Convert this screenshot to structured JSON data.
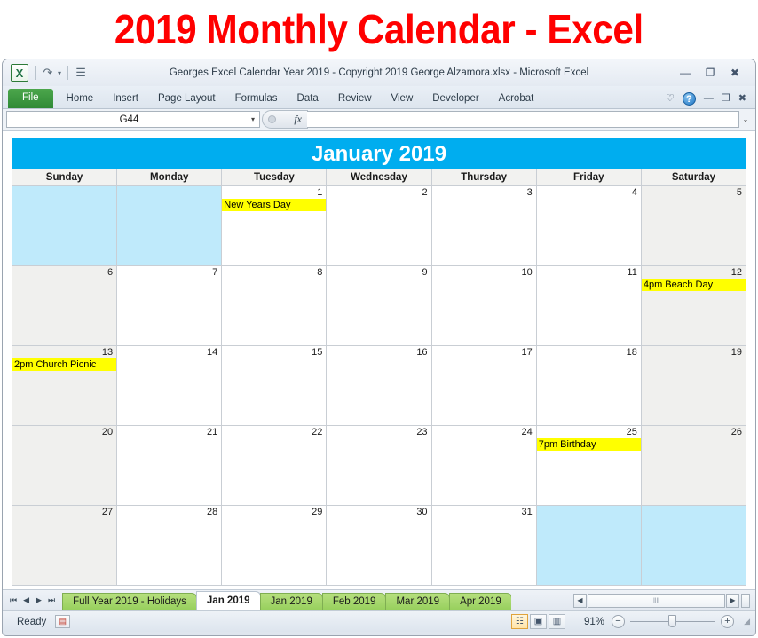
{
  "banner": {
    "title": "2019 Monthly Calendar - Excel",
    "color": "#FF0000"
  },
  "window": {
    "title": "Georges Excel Calendar Year 2019 - Copyright 2019 George Alzamora.xlsx  -  Microsoft Excel",
    "logo_text": "X",
    "quick_access": [
      {
        "name": "redo-icon",
        "glyph": "↷"
      },
      {
        "name": "qat-dropdown-icon",
        "glyph": "▾"
      },
      {
        "name": "customize-qat-icon",
        "glyph": "☰"
      }
    ],
    "window_controls": [
      {
        "name": "minimize",
        "glyph": "—"
      },
      {
        "name": "restore",
        "glyph": "❐"
      },
      {
        "name": "close",
        "glyph": "✖"
      }
    ]
  },
  "ribbon": {
    "file_tab": "File",
    "tabs": [
      "Home",
      "Insert",
      "Page Layout",
      "Formulas",
      "Data",
      "Review",
      "View",
      "Developer",
      "Acrobat"
    ],
    "right_controls": [
      {
        "name": "collapse-ribbon-icon",
        "glyph": "♡"
      },
      {
        "name": "help-icon",
        "glyph": "?"
      },
      {
        "name": "minimize-window-icon",
        "glyph": "—"
      },
      {
        "name": "restore-window-icon",
        "glyph": "❐"
      },
      {
        "name": "close-window-icon",
        "glyph": "✖"
      }
    ]
  },
  "formula_bar": {
    "name_box_value": "G44",
    "name_box_placeholder": "Name Box",
    "fx_label": "fx",
    "formula_value": "",
    "formula_placeholder": "",
    "expand_glyph": "⌄",
    "caret_glyph": "▾"
  },
  "calendar": {
    "title": "January 2019",
    "header_color": "#00ADEF",
    "weekend_color": "#F0F0EE",
    "blank_color": "#BFEAFB",
    "event_color": "#FFFF00",
    "day_headers": [
      "Sunday",
      "Monday",
      "Tuesday",
      "Wednesday",
      "Thursday",
      "Friday",
      "Saturday"
    ],
    "weeks": [
      [
        {
          "num": "",
          "event": "",
          "style": "blank"
        },
        {
          "num": "",
          "event": "",
          "style": "blank"
        },
        {
          "num": "1",
          "event": "New Years Day",
          "style": "plain"
        },
        {
          "num": "2",
          "event": "",
          "style": "plain"
        },
        {
          "num": "3",
          "event": "",
          "style": "plain"
        },
        {
          "num": "4",
          "event": "",
          "style": "plain"
        },
        {
          "num": "5",
          "event": "",
          "style": "weekend"
        }
      ],
      [
        {
          "num": "6",
          "event": "",
          "style": "weekend"
        },
        {
          "num": "7",
          "event": "",
          "style": "plain"
        },
        {
          "num": "8",
          "event": "",
          "style": "plain"
        },
        {
          "num": "9",
          "event": "",
          "style": "plain"
        },
        {
          "num": "10",
          "event": "",
          "style": "plain"
        },
        {
          "num": "11",
          "event": "",
          "style": "plain"
        },
        {
          "num": "12",
          "event": "4pm Beach Day",
          "style": "weekend"
        }
      ],
      [
        {
          "num": "13",
          "event": "2pm Church Picnic",
          "style": "weekend"
        },
        {
          "num": "14",
          "event": "",
          "style": "plain"
        },
        {
          "num": "15",
          "event": "",
          "style": "plain"
        },
        {
          "num": "16",
          "event": "",
          "style": "plain"
        },
        {
          "num": "17",
          "event": "",
          "style": "plain"
        },
        {
          "num": "18",
          "event": "",
          "style": "plain"
        },
        {
          "num": "19",
          "event": "",
          "style": "weekend"
        }
      ],
      [
        {
          "num": "20",
          "event": "",
          "style": "weekend"
        },
        {
          "num": "21",
          "event": "",
          "style": "plain"
        },
        {
          "num": "22",
          "event": "",
          "style": "plain"
        },
        {
          "num": "23",
          "event": "",
          "style": "plain"
        },
        {
          "num": "24",
          "event": "",
          "style": "plain"
        },
        {
          "num": "25",
          "event": "7pm Birthday",
          "style": "plain"
        },
        {
          "num": "26",
          "event": "",
          "style": "weekend"
        }
      ],
      [
        {
          "num": "27",
          "event": "",
          "style": "weekend"
        },
        {
          "num": "28",
          "event": "",
          "style": "plain"
        },
        {
          "num": "29",
          "event": "",
          "style": "plain"
        },
        {
          "num": "30",
          "event": "",
          "style": "plain"
        },
        {
          "num": "31",
          "event": "",
          "style": "plain"
        },
        {
          "num": "",
          "event": "",
          "style": "blank"
        },
        {
          "num": "",
          "event": "",
          "style": "blank"
        }
      ]
    ]
  },
  "sheet_tabs": {
    "nav": [
      {
        "name": "first-sheet-icon",
        "glyph": "⏮"
      },
      {
        "name": "previous-sheet-icon",
        "glyph": "◀"
      },
      {
        "name": "next-sheet-icon",
        "glyph": "▶"
      },
      {
        "name": "last-sheet-icon",
        "glyph": "⏭"
      }
    ],
    "tabs": [
      {
        "label": "Full Year 2019 - Holidays",
        "active": false
      },
      {
        "label": "Jan 2019",
        "active": true
      },
      {
        "label": "Jan 2019",
        "active": false
      },
      {
        "label": "Feb 2019",
        "active": false
      },
      {
        "label": "Mar 2019",
        "active": false
      },
      {
        "label": "Apr 2019",
        "active": false
      }
    ],
    "hscroll": {
      "left_glyph": "◀",
      "right_glyph": "▶",
      "grip": "‖‖"
    }
  },
  "status_bar": {
    "state": "Ready",
    "macro_icon": "▤",
    "views": [
      {
        "name": "normal-view-button",
        "glyph": "☷",
        "active": true
      },
      {
        "name": "page-layout-view-button",
        "glyph": "▣",
        "active": false
      },
      {
        "name": "page-break-preview-button",
        "glyph": "▥",
        "active": false
      }
    ],
    "zoom": "91%",
    "zoom_out_glyph": "−",
    "zoom_in_glyph": "+"
  }
}
